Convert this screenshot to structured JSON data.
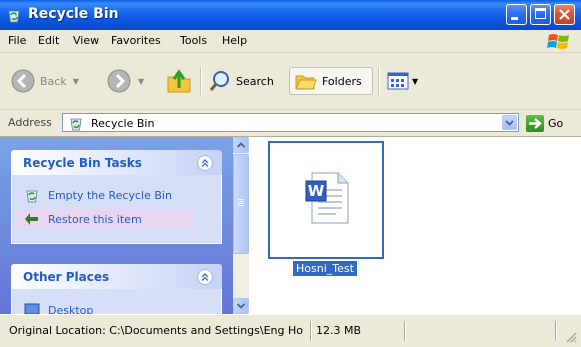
{
  "window": {
    "title": "Recycle Bin"
  },
  "menu": {
    "items": [
      "File",
      "Edit",
      "View",
      "Favorites",
      "Tools",
      "Help"
    ]
  },
  "toolbar": {
    "back_label": "Back",
    "search_label": "Search",
    "folders_label": "Folders"
  },
  "address": {
    "label": "Address",
    "value": "Recycle Bin",
    "go_label": "Go"
  },
  "tasks_panel": {
    "title": "Recycle Bin Tasks",
    "items": [
      {
        "label": "Empty the Recycle Bin",
        "icon": "empty-recycle-bin-icon"
      },
      {
        "label": "Restore this item",
        "icon": "restore-icon"
      }
    ]
  },
  "places_panel": {
    "title": "Other Places",
    "items": [
      {
        "label": "Desktop",
        "icon": "desktop-icon"
      }
    ]
  },
  "files": [
    {
      "name": "Hosni_Test",
      "icon": "word-document-icon"
    }
  ],
  "status": {
    "location": "Original Location: C:\\Documents and Settings\\Eng Ho",
    "size": "12.3 MB"
  },
  "colors": {
    "titlebar": "#0b55dc",
    "selection": "#316ac5",
    "task_link": "#215dc6",
    "task_pane": "#7ba2e7"
  }
}
